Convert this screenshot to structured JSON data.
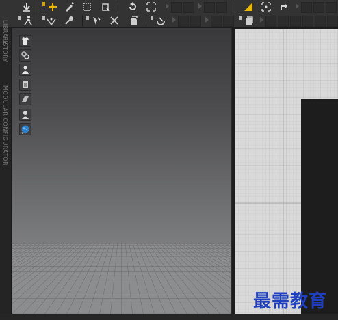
{
  "colors": {
    "toolbar_bg": "#333333",
    "panel_bg": "#242424",
    "viewport_top": "#39393b",
    "viewport_bottom": "#8a8a8b",
    "pattern_bg": "#d9d9d9",
    "accent_yellow": "#e8b800",
    "watermark": "#1f3fbf"
  },
  "left_panel": {
    "tabs": [
      "LIBRARY",
      "HISTORY",
      "MODULAR CONFIGURATOR"
    ]
  },
  "toolbar_top": {
    "icons": [
      "download-icon",
      "move-tool-icon",
      "edit-pattern-icon",
      "select-box-icon",
      "transform-icon",
      "rotate-icon",
      "expand-icon",
      "triangle-fill-icon",
      "pin-move-icon",
      "redo-arrow-icon"
    ]
  },
  "toolbar_second": {
    "icons": [
      "run-avatar-icon",
      "fold-arrangement-icon",
      "pin-tool-icon",
      "tack-icon",
      "fold-sewing-icon",
      "garment-copy-icon",
      "fabric-tag-icon",
      "pattern-copy-icon"
    ]
  },
  "viewport_tools": {
    "icons": [
      "show-garment-icon",
      "show-sewing-icon",
      "show-avatar-icon",
      "avatar-clothes-icon",
      "texture-surface-icon",
      "avatar-silhouette-icon",
      "globe-render-icon"
    ]
  },
  "status_bar": {
    "visible_text": []
  },
  "watermark": {
    "text": "最需教育"
  }
}
